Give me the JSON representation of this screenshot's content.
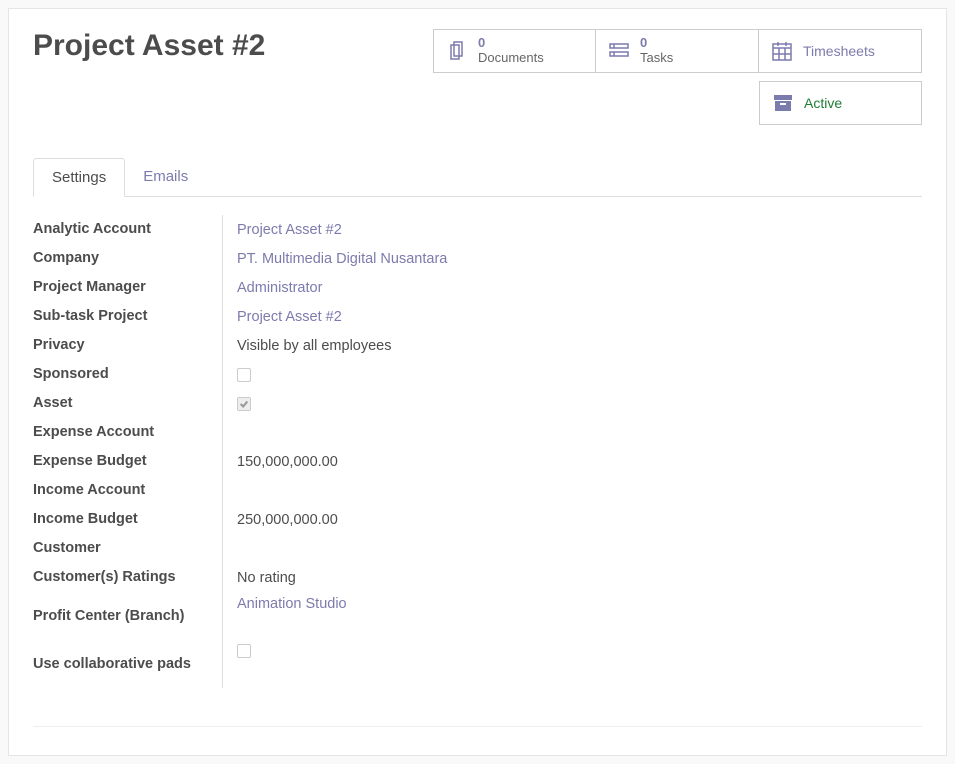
{
  "header": {
    "title": "Project Asset #2",
    "stats": {
      "documents": {
        "count": "0",
        "label": "Documents"
      },
      "tasks": {
        "count": "0",
        "label": "Tasks"
      },
      "timesheets": {
        "label": "Timesheets"
      },
      "active": {
        "label": "Active"
      }
    }
  },
  "tabs": {
    "settings": "Settings",
    "emails": "Emails"
  },
  "settings": {
    "analytic_account": {
      "label": "Analytic Account",
      "value": "Project Asset #2"
    },
    "company": {
      "label": "Company",
      "value": "PT. Multimedia Digital Nusantara"
    },
    "project_manager": {
      "label": "Project Manager",
      "value": "Administrator"
    },
    "subtask_project": {
      "label": "Sub-task Project",
      "value": "Project Asset #2"
    },
    "privacy": {
      "label": "Privacy",
      "value": "Visible by all employees"
    },
    "sponsored": {
      "label": "Sponsored"
    },
    "asset": {
      "label": "Asset"
    },
    "expense_account": {
      "label": "Expense Account",
      "value": ""
    },
    "expense_budget": {
      "label": "Expense Budget",
      "value": "150,000,000.00"
    },
    "income_account": {
      "label": "Income Account",
      "value": ""
    },
    "income_budget": {
      "label": "Income Budget",
      "value": "250,000,000.00"
    },
    "customer": {
      "label": "Customer",
      "value": ""
    },
    "customer_ratings": {
      "label": "Customer(s) Ratings",
      "value": "No rating"
    },
    "profit_center": {
      "label": "Profit Center (Branch)",
      "value": "Animation Studio"
    },
    "collab_pads": {
      "label": "Use collaborative pads"
    }
  }
}
